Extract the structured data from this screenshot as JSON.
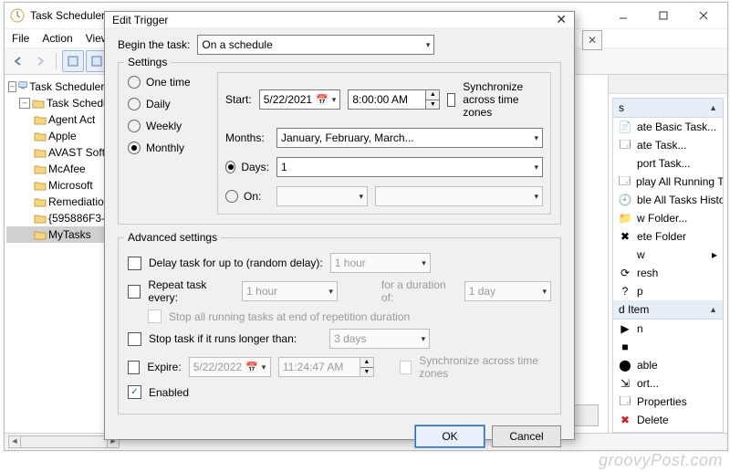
{
  "main_window": {
    "title": "Task Scheduler",
    "menu": [
      "File",
      "Action",
      "View"
    ],
    "tree": {
      "root": "Task Scheduler (Lo",
      "library": "Task Schedule",
      "folders": [
        "Agent Act",
        "Apple",
        "AVAST Soft",
        "McAfee",
        "Microsoft",
        "Remediatio",
        "{595886F3-",
        "MyTasks"
      ]
    }
  },
  "actions": {
    "section1": "s",
    "items1": [
      "ate Basic Task...",
      "ate Task...",
      "port Task...",
      "play All Running Ta...",
      "ble All Tasks History",
      "w Folder...",
      "ete Folder",
      "w",
      "resh",
      "p"
    ],
    "section2": "d Item",
    "items2": [
      "n",
      "",
      "able",
      "ort...",
      "Properties",
      "Delete"
    ]
  },
  "dialog": {
    "title": "Edit Trigger",
    "begin_label": "Begin the task:",
    "begin_value": "On a schedule",
    "settings_legend": "Settings",
    "radios": {
      "one_time": "One time",
      "daily": "Daily",
      "weekly": "Weekly",
      "monthly": "Monthly"
    },
    "start_label": "Start:",
    "start_date": "5/22/2021",
    "start_time": "8:00:00 AM",
    "sync_tz": "Synchronize across time zones",
    "months_label": "Months:",
    "months_value": "January, February, March...",
    "days_label": "Days:",
    "days_value": "1",
    "on_label": "On:",
    "advanced_legend": "Advanced settings",
    "delay_label": "Delay task for up to (random delay):",
    "delay_value": "1 hour",
    "repeat_label": "Repeat task every:",
    "repeat_value": "1 hour",
    "duration_label": "for a duration of:",
    "duration_value": "1 day",
    "stop_all_label": "Stop all running tasks at end of repetition duration",
    "stop_if_label": "Stop task if it runs longer than:",
    "stop_if_value": "3 days",
    "expire_label": "Expire:",
    "expire_date": "5/22/2022",
    "expire_time": "11:24:47 AM",
    "expire_sync": "Synchronize across time zones",
    "enabled_label": "Enabled",
    "ok": "OK",
    "cancel": "Cancel"
  },
  "watermark": "groovyPost.com"
}
